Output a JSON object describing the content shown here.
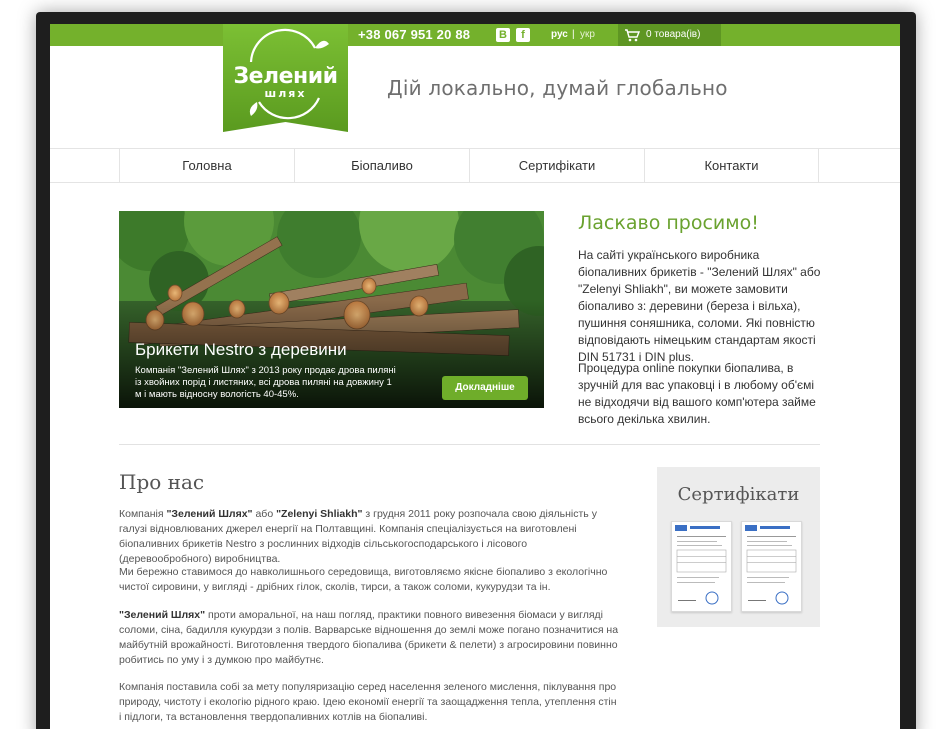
{
  "header": {
    "phone": "+38 067 951 20 88",
    "social": [
      {
        "label": "В",
        "icon": "vk-icon"
      },
      {
        "label": "f",
        "icon": "facebook-icon"
      }
    ],
    "lang_ru": "рус",
    "lang_sep": "|",
    "lang_ua": "укр",
    "cart_label": "0 товара(ів)",
    "logo_line1": "Зелений",
    "logo_line2": "шлях",
    "slogan": "Дій локально, думай глобально"
  },
  "nav": {
    "items": [
      "Головна",
      "Біопаливо",
      "Сертифікати",
      "Контакти"
    ]
  },
  "hero": {
    "title": "Брикети Nestro з деревини",
    "text": "Компанія \"Зелений Шлях\" з 2013 року продає дрова пиляні із хвойних порід і листяних, всі дрова пиляні на довжину 1 м і мають відносну вологість 40-45%.",
    "button": "Докладніше"
  },
  "welcome": {
    "title": "Ласкаво просимо!",
    "p1": "На сайті українського виробника біопаливних брикетів - \"Зелений Шлях\" або \"Zelenyi Shliakh\", ви можете замовити біопаливо з: деревини (береза і вільха), пушиння соняшника, соломи. Які повністю відповідають німецьким стандартам якості DIN 51731 і DIN plus.",
    "p2": "Процедура online покупки біопалива, в зручній для вас упаковці і в любому об'ємі не відходячи від вашого комп'ютера займе всього декілька хвилин."
  },
  "about": {
    "title": "Про нас",
    "p1_a": "Компанія ",
    "p1_b1": "\"Зелений Шлях\"",
    "p1_c": " або ",
    "p1_b2": "\"Zelenyi Shliakh\"",
    "p1_d": " з грудня 2011 року розпочала свою діяльність у галузі відновлюваних джерел енергії на Полтавщині. Компанія спеціалізується на виготовлені біопаливних брикетів Nestro з рослинних відходів сільськогосподарського і лісового (деревообробного) виробництва.",
    "p2": "Ми бережно ставимося до навколишнього середовища, виготовляємо якісне біопаливо з екологічно чистої сировини, у вигляді - дрібних гілок, сколів, тирси, а також соломи, кукурудзи та ін.",
    "p3_b": "\"Зелений Шлях\"",
    "p3_rest": " проти аморальної, на наш погляд, практики повного вивезення біомаси у вигляді соломи, сіна, бадилля кукурдзи з полів. Варварське відношення до землі може погано позначитися на майбутній врожайності. Виготовлення твердого біопалива (брикети & пелети) з агросировини повинно робитись по уму і з думкою про майбутнє.",
    "p4": "Компанія поставила собі за мету популяризацію серед населення зеленого мислення, піклування про природу, чистоту і екологію рідного краю. Ідею економії енергії та заощадження тепла, утеплення стін і підлоги, та встановлення твердопаливних котлів на біопаливі."
  },
  "certificates": {
    "title": "Сертифікати",
    "items": [
      "certificate-1",
      "certificate-2"
    ]
  },
  "colors": {
    "brand_green": "#74b12c",
    "dark_green": "#5e9623",
    "accent_text": "#6aa22f"
  }
}
